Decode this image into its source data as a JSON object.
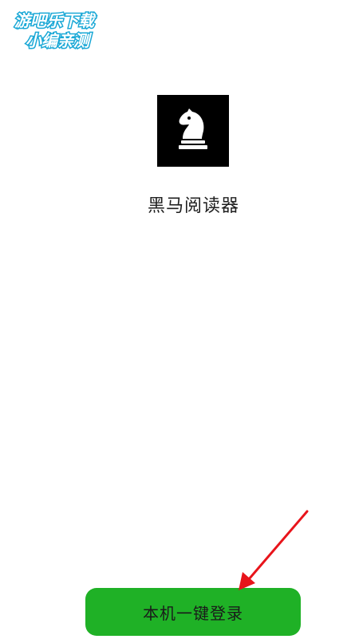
{
  "watermark": {
    "line1": "游吧乐下载",
    "line2": "小编亲测"
  },
  "app": {
    "name": "黑马阅读器",
    "logo_icon": "chess-knight-icon"
  },
  "login": {
    "button_label": "本机一键登录"
  },
  "colors": {
    "button_bg": "#1fb126",
    "logo_bg": "#000000",
    "arrow": "#e8141b",
    "watermark_text": "#1aa8d6"
  }
}
